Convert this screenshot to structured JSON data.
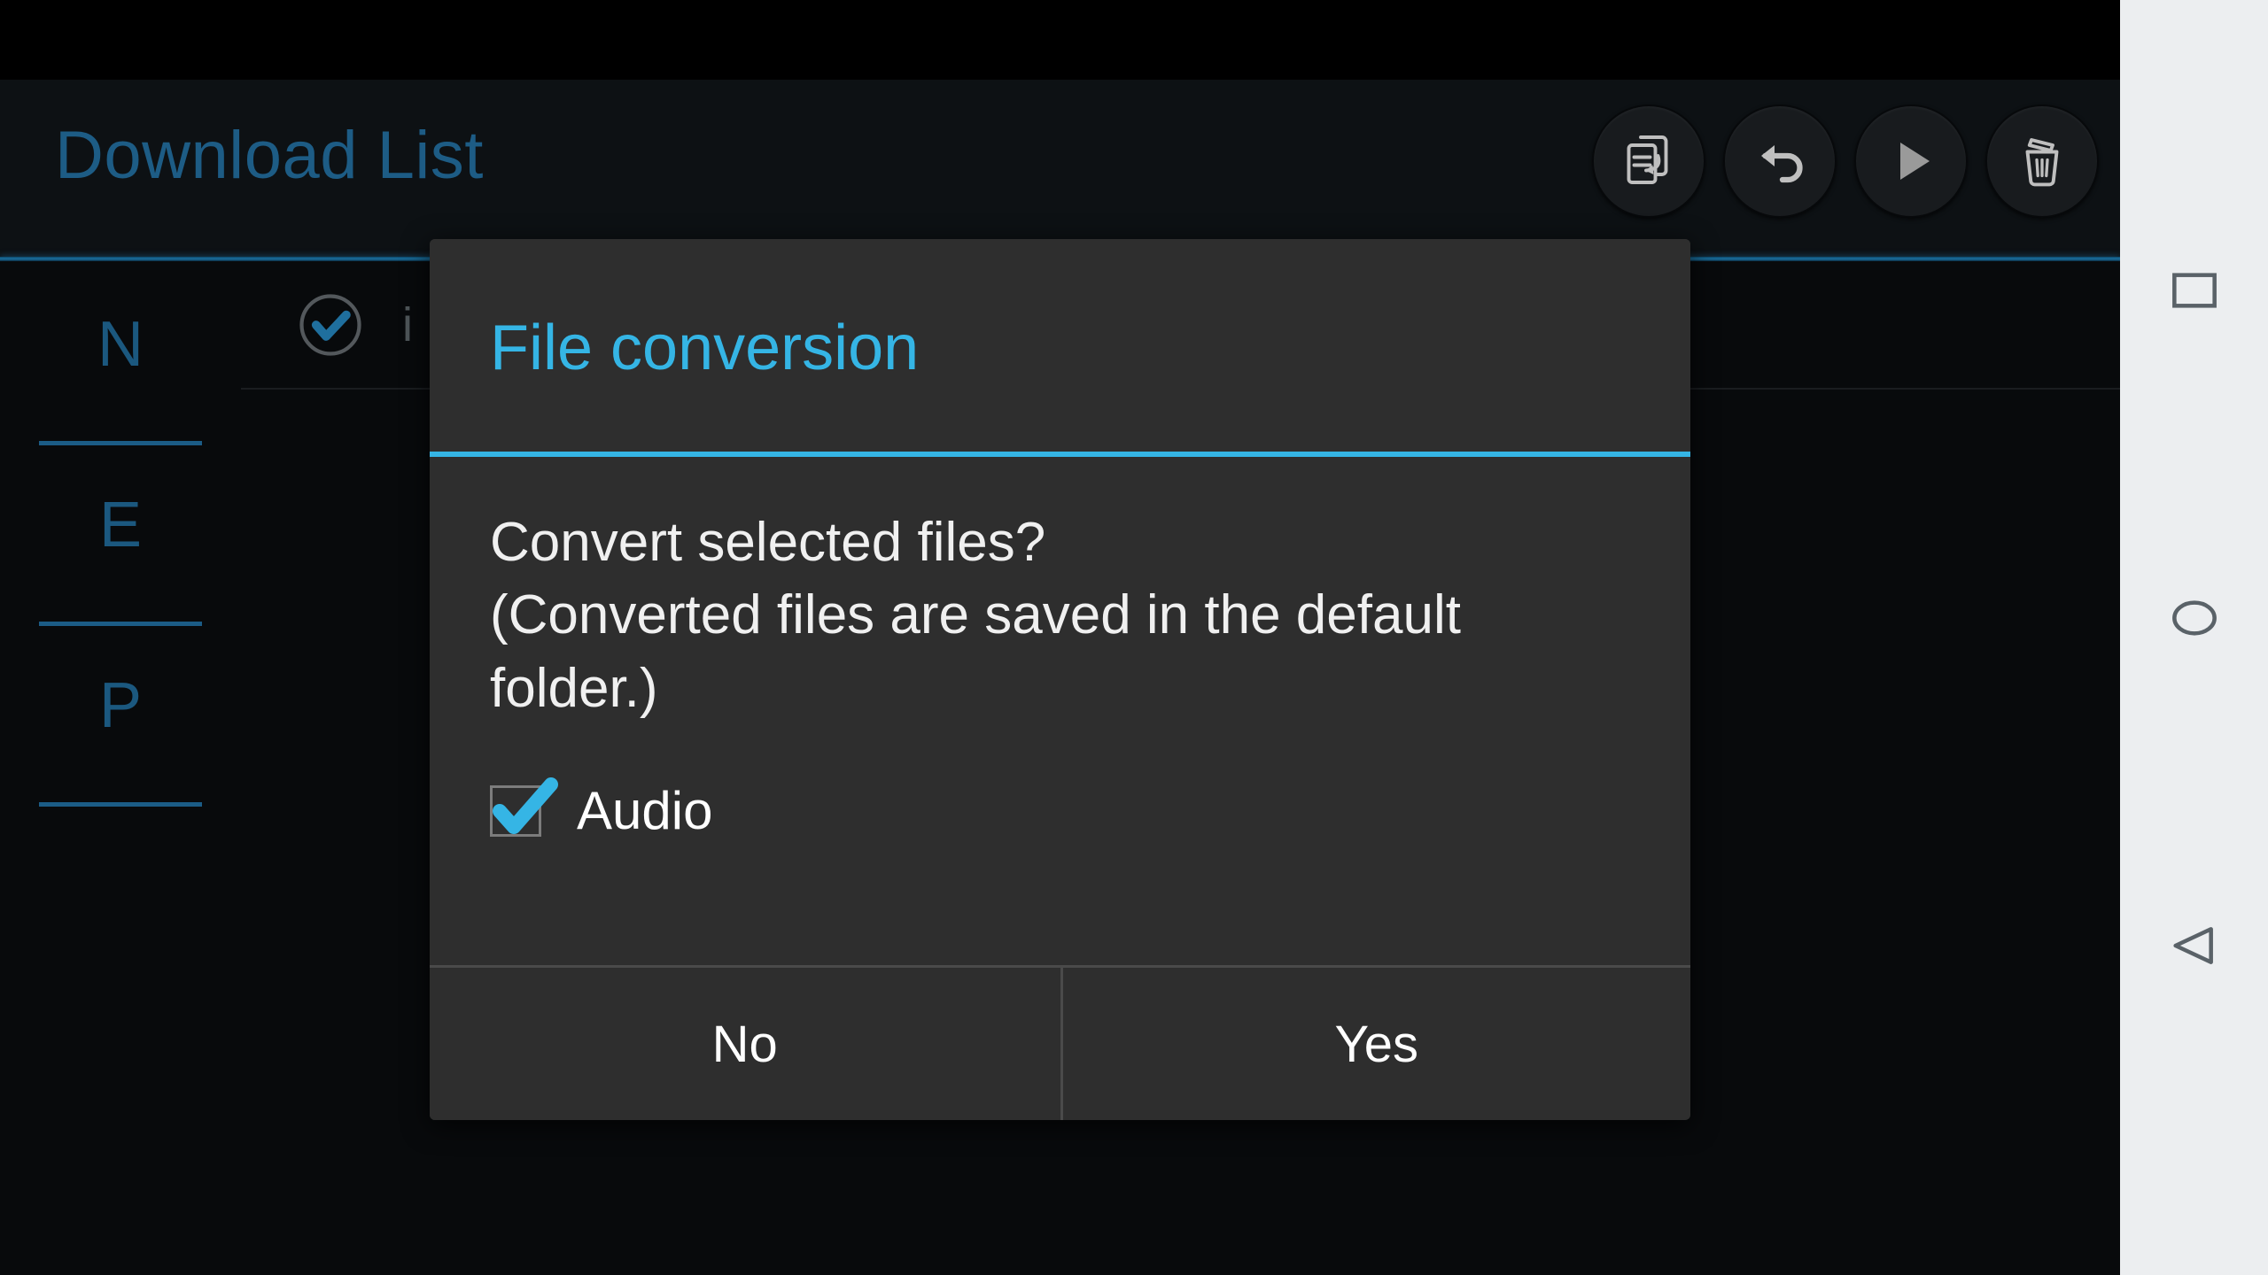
{
  "app": {
    "title": "Download List"
  },
  "action_bar": {
    "buttons": [
      {
        "name": "file-conversion-icon",
        "label": "File conversion"
      },
      {
        "name": "undo-icon",
        "label": "Undo"
      },
      {
        "name": "play-icon",
        "label": "Play"
      },
      {
        "name": "delete-icon",
        "label": "Delete"
      }
    ]
  },
  "index_sidebar": {
    "items": [
      {
        "letter": "N"
      },
      {
        "letter": "E"
      },
      {
        "letter": "P"
      }
    ]
  },
  "list": {
    "rows": [
      {
        "label": "i",
        "checked": true
      }
    ]
  },
  "dialog": {
    "title": "File conversion",
    "message": "Convert selected files?\n(Converted files are saved in the default folder.)",
    "checkbox": {
      "label": "Audio",
      "checked": true
    },
    "buttons": {
      "negative": "No",
      "positive": "Yes"
    }
  },
  "nav_bar": {
    "recents": "recents-square-icon",
    "home": "home-circle-icon",
    "back": "back-triangle-icon"
  },
  "colors": {
    "accent": "#35b5e5",
    "title": "#1d5c85",
    "dialog_bg": "#2e2e2e",
    "app_bg": "#0a0c0e",
    "nav_bg": "#eceef0",
    "nav_icon": "#5a6268"
  }
}
